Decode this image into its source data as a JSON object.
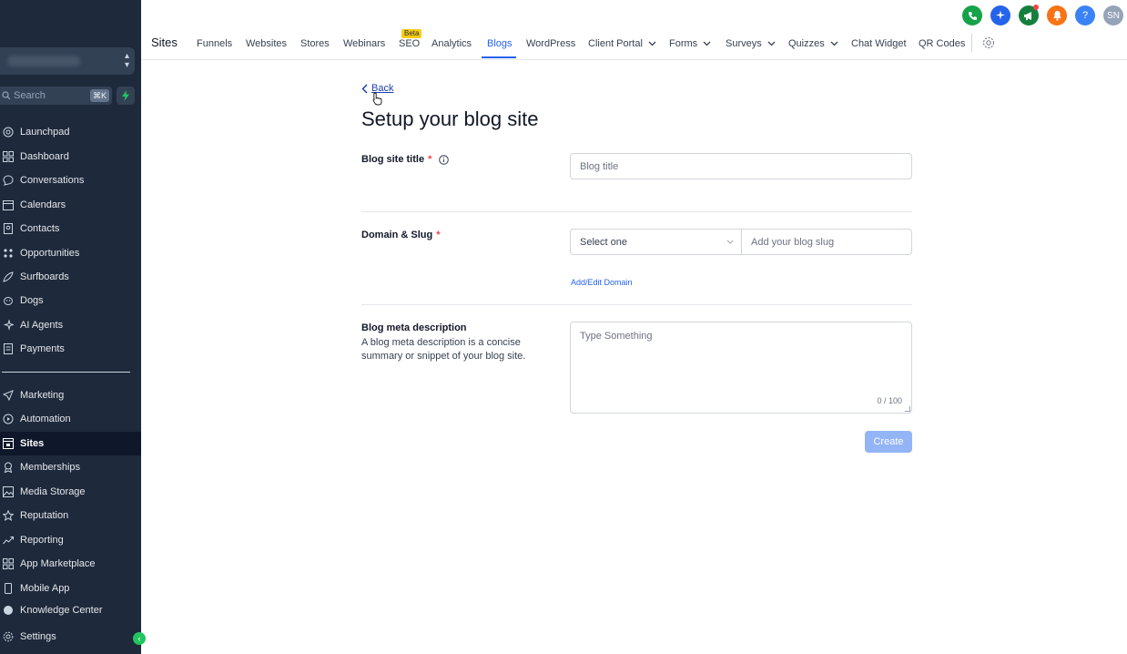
{
  "sidebar": {
    "search_placeholder": "Search",
    "search_shortcut": "⌘K",
    "items": [
      {
        "label": "Launchpad",
        "icon": "launchpad-icon"
      },
      {
        "label": "Dashboard",
        "icon": "dashboard-icon"
      },
      {
        "label": "Conversations",
        "icon": "chat-bubble-icon"
      },
      {
        "label": "Calendars",
        "icon": "calendar-icon"
      },
      {
        "label": "Contacts",
        "icon": "contacts-icon"
      },
      {
        "label": "Opportunities",
        "icon": "opportunities-icon"
      },
      {
        "label": "Surfboards",
        "icon": "surfboard-icon"
      },
      {
        "label": "Dogs",
        "icon": "dog-icon"
      },
      {
        "label": "AI Agents",
        "icon": "sparkle-icon"
      },
      {
        "label": "Payments",
        "icon": "receipt-icon"
      }
    ],
    "items2": [
      {
        "label": "Marketing",
        "icon": "send-icon"
      },
      {
        "label": "Automation",
        "icon": "automation-icon"
      },
      {
        "label": "Sites",
        "icon": "sites-icon",
        "active": true
      },
      {
        "label": "Memberships",
        "icon": "memberships-icon"
      },
      {
        "label": "Media Storage",
        "icon": "image-icon"
      },
      {
        "label": "Reputation",
        "icon": "star-icon"
      },
      {
        "label": "Reporting",
        "icon": "trend-icon"
      },
      {
        "label": "App Marketplace",
        "icon": "grid-icon"
      },
      {
        "label": "Mobile App",
        "icon": "mobile-icon"
      },
      {
        "label": "Knowledge Center",
        "icon": "book-icon"
      }
    ],
    "settings_label": "Settings"
  },
  "header": {
    "title": "Sites",
    "beta_badge": "Beta",
    "tabs": [
      {
        "label": "Funnels"
      },
      {
        "label": "Websites"
      },
      {
        "label": "Stores"
      },
      {
        "label": "Webinars"
      },
      {
        "label": "SEO"
      },
      {
        "label": "Analytics"
      },
      {
        "label": "Blogs",
        "active": true
      },
      {
        "label": "WordPress"
      },
      {
        "label": "Client Portal"
      },
      {
        "label": "Forms"
      },
      {
        "label": "Surveys"
      },
      {
        "label": "Quizzes"
      },
      {
        "label": "Chat Widget"
      },
      {
        "label": "QR Codes"
      }
    ],
    "avatar_initials": "SN",
    "help_label": "?",
    "colors": {
      "phone": "#16a34a",
      "ai": "#2563eb",
      "announce": "#15803d",
      "bell": "#f97316",
      "help": "#3b82f6",
      "avatar": "#94a3b8"
    }
  },
  "form": {
    "back_label": "Back",
    "heading": "Setup your blog site",
    "title_label": "Blog site title",
    "title_placeholder": "Blog title",
    "domain_label": "Domain & Slug",
    "domain_select": "Select one",
    "slug_placeholder": "Add your blog slug",
    "add_edit_domain": "Add/Edit Domain",
    "meta_label": "Blog meta description",
    "meta_help": "A blog meta description is a concise summary or snippet of your blog site.",
    "meta_placeholder": "Type Something",
    "meta_counter": "0 / 100",
    "create_label": "Create",
    "required_mark": "*"
  }
}
